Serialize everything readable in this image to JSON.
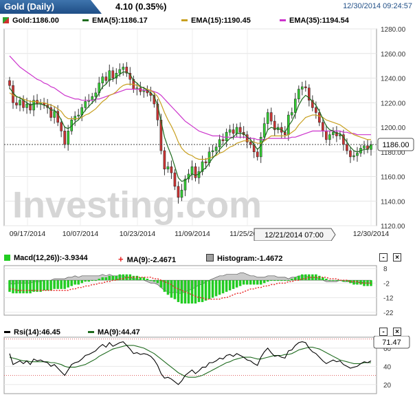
{
  "header": {
    "title": "Gold (Daily)",
    "change": "4.10 (0.35%)",
    "datetime": "12/30/2014 09:24:57"
  },
  "price_legend": [
    {
      "label": "Gold:1186.00",
      "color": "#2ea02e",
      "icon": "candlestick-icon"
    },
    {
      "label": "EMA(5):1186.17",
      "color": "#1e6b1e",
      "icon": "line-swatch"
    },
    {
      "label": "EMA(15):1190.45",
      "color": "#c8a020",
      "icon": "line-swatch"
    },
    {
      "label": "EMA(35):1194.54",
      "color": "#cc33cc",
      "icon": "line-swatch"
    }
  ],
  "macd_legend": [
    {
      "label": "Macd(12,26)):-3.9344",
      "color": "#22cc22",
      "icon": "square-swatch"
    },
    {
      "label": "MA(9):-2.4671",
      "color": "#e82020",
      "icon": "plus-icon"
    },
    {
      "label": "Histogram:-1.4672",
      "color": "#a0a0a0",
      "icon": "square-swatch"
    }
  ],
  "rsi_legend": [
    {
      "label": "Rsi(14):46.45",
      "color": "#000000",
      "icon": "line-swatch"
    },
    {
      "label": "MA(9):44.47",
      "color": "#1e6b1e",
      "icon": "line-swatch"
    }
  ],
  "controls": {
    "minimize": "-",
    "close": "×"
  },
  "watermark": "Investing.com",
  "crosshair_label": "12/21/2014 07:00",
  "chart_data": [
    {
      "type": "candlestick",
      "title": "Gold (Daily)",
      "ylim": [
        1120,
        1280
      ],
      "y_ticks": [
        1280,
        1260,
        1240,
        1220,
        1200,
        1180,
        1160,
        1140,
        1120
      ],
      "x_tick_labels": [
        "09/17/2014",
        "10/07/2014",
        "10/23/2014",
        "11/09/2014",
        "11/25/2014",
        "12/30/2014"
      ],
      "last_price": 1186.0,
      "last_price_label": "1186.00",
      "closes": [
        1234,
        1220,
        1218,
        1222,
        1216,
        1219,
        1214,
        1222,
        1219,
        1220,
        1218,
        1216,
        1208,
        1213,
        1204,
        1197,
        1186,
        1197,
        1206,
        1209,
        1210,
        1216,
        1221,
        1222,
        1225,
        1228,
        1236,
        1241,
        1238,
        1246,
        1240,
        1244,
        1247,
        1249,
        1244,
        1239,
        1231,
        1232,
        1229,
        1230,
        1228,
        1226,
        1219,
        1206,
        1181,
        1166,
        1168,
        1163,
        1152,
        1143,
        1149,
        1158,
        1162,
        1168,
        1159,
        1164,
        1172,
        1171,
        1180,
        1181,
        1184,
        1190,
        1189,
        1196,
        1198,
        1195,
        1200,
        1196,
        1194,
        1188,
        1186,
        1180,
        1176,
        1192,
        1203,
        1212,
        1205,
        1198,
        1200,
        1196,
        1194,
        1210,
        1212,
        1223,
        1231,
        1233,
        1232,
        1222,
        1216,
        1212,
        1204,
        1197,
        1190,
        1194,
        1196,
        1193,
        1194,
        1186,
        1181,
        1176,
        1177,
        1179,
        1183,
        1185,
        1182,
        1186
      ],
      "ema5": [
        1232,
        1228,
        1225,
        1224,
        1222,
        1220,
        1218,
        1219,
        1219,
        1219,
        1218,
        1217,
        1214,
        1214,
        1211,
        1206,
        1200,
        1199,
        1201,
        1204,
        1206,
        1210,
        1214,
        1217,
        1220,
        1223,
        1228,
        1233,
        1235,
        1239,
        1239,
        1241,
        1243,
        1245,
        1245,
        1243,
        1238,
        1236,
        1233,
        1232,
        1230,
        1228,
        1225,
        1218,
        1205,
        1192,
        1184,
        1177,
        1168,
        1159,
        1156,
        1157,
        1159,
        1162,
        1161,
        1162,
        1165,
        1167,
        1171,
        1175,
        1178,
        1182,
        1185,
        1188,
        1191,
        1192,
        1195,
        1195,
        1195,
        1192,
        1190,
        1186,
        1182,
        1185,
        1191,
        1198,
        1200,
        1199,
        1199,
        1198,
        1196,
        1201,
        1205,
        1211,
        1218,
        1223,
        1226,
        1224,
        1221,
        1218,
        1213,
        1207,
        1201,
        1198,
        1197,
        1195,
        1195,
        1192,
        1188,
        1184,
        1181,
        1180,
        1181,
        1182,
        1182,
        1186
      ],
      "ema15": [
        1228,
        1226,
        1225,
        1224,
        1223,
        1222,
        1221,
        1221,
        1221,
        1220,
        1220,
        1219,
        1218,
        1217,
        1215,
        1213,
        1209,
        1207,
        1207,
        1207,
        1207,
        1208,
        1210,
        1211,
        1213,
        1215,
        1218,
        1221,
        1223,
        1226,
        1227,
        1229,
        1232,
        1234,
        1235,
        1235,
        1235,
        1234,
        1233,
        1232,
        1231,
        1230,
        1228,
        1225,
        1219,
        1212,
        1206,
        1201,
        1195,
        1188,
        1183,
        1180,
        1178,
        1177,
        1175,
        1174,
        1174,
        1174,
        1175,
        1176,
        1177,
        1179,
        1180,
        1182,
        1184,
        1185,
        1187,
        1188,
        1189,
        1189,
        1189,
        1188,
        1187,
        1187,
        1189,
        1191,
        1193,
        1193,
        1193,
        1193,
        1193,
        1194,
        1196,
        1198,
        1202,
        1205,
        1208,
        1209,
        1210,
        1210,
        1209,
        1208,
        1206,
        1205,
        1204,
        1203,
        1202,
        1200,
        1198,
        1196,
        1194,
        1193,
        1192,
        1191,
        1190,
        1190
      ],
      "ema35": [
        1258,
        1255,
        1252,
        1249,
        1247,
        1245,
        1243,
        1241,
        1239,
        1238,
        1236,
        1235,
        1233,
        1232,
        1230,
        1228,
        1226,
        1225,
        1224,
        1223,
        1223,
        1222,
        1222,
        1222,
        1222,
        1223,
        1223,
        1224,
        1225,
        1226,
        1227,
        1228,
        1229,
        1230,
        1231,
        1231,
        1231,
        1231,
        1231,
        1230,
        1230,
        1230,
        1229,
        1228,
        1226,
        1223,
        1220,
        1217,
        1214,
        1211,
        1208,
        1205,
        1203,
        1201,
        1199,
        1197,
        1196,
        1195,
        1194,
        1193,
        1193,
        1193,
        1192,
        1192,
        1192,
        1192,
        1192,
        1192,
        1192,
        1192,
        1191,
        1191,
        1190,
        1190,
        1190,
        1191,
        1191,
        1191,
        1191,
        1191,
        1191,
        1191,
        1192,
        1192,
        1193,
        1194,
        1195,
        1196,
        1197,
        1197,
        1197,
        1197,
        1197,
        1197,
        1197,
        1197,
        1197,
        1196,
        1196,
        1195,
        1195,
        1194,
        1194,
        1194,
        1194,
        1194
      ]
    },
    {
      "type": "line",
      "title": "Macd(12,26)",
      "ylim": [
        -24,
        10
      ],
      "y_ticks": [
        8,
        -2,
        -12,
        -22
      ],
      "macd": [
        -8,
        -9,
        -9,
        -9,
        -9,
        -9,
        -9,
        -8,
        -8,
        -8,
        -7,
        -7,
        -7,
        -6,
        -6,
        -6,
        -6,
        -5,
        -4,
        -3,
        -3,
        -2,
        -1,
        -1,
        0,
        0,
        1,
        2,
        2,
        3,
        3,
        3,
        4,
        4,
        4,
        4,
        3,
        3,
        2,
        2,
        1,
        0,
        -1,
        -2,
        -5,
        -8,
        -10,
        -12,
        -13,
        -15,
        -16,
        -16,
        -16,
        -16,
        -16,
        -15,
        -15,
        -14,
        -13,
        -12,
        -11,
        -10,
        -9,
        -8,
        -7,
        -6,
        -5,
        -4,
        -3,
        -3,
        -3,
        -3,
        -3,
        -3,
        -2,
        -1,
        0,
        0,
        0,
        0,
        0,
        0,
        1,
        2,
        3,
        4,
        4,
        4,
        4,
        4,
        3,
        2,
        1,
        0,
        0,
        0,
        0,
        -1,
        -1,
        -2,
        -3,
        -3,
        -3,
        -4,
        -4,
        -4
      ],
      "signal": [
        -6,
        -6,
        -7,
        -7,
        -7,
        -7,
        -7,
        -7,
        -7,
        -7,
        -7,
        -7,
        -7,
        -7,
        -7,
        -7,
        -7,
        -7,
        -6,
        -6,
        -5,
        -5,
        -4,
        -4,
        -3,
        -3,
        -2,
        -2,
        -1,
        -1,
        0,
        0,
        1,
        1,
        2,
        2,
        2,
        2,
        2,
        2,
        2,
        2,
        1,
        1,
        0,
        -1,
        -2,
        -3,
        -5,
        -6,
        -7,
        -8,
        -9,
        -10,
        -11,
        -12,
        -12,
        -13,
        -13,
        -13,
        -13,
        -13,
        -12,
        -12,
        -11,
        -10,
        -9,
        -9,
        -8,
        -7,
        -6,
        -6,
        -5,
        -5,
        -4,
        -4,
        -3,
        -3,
        -2,
        -2,
        -2,
        -1,
        -1,
        0,
        0,
        1,
        1,
        2,
        2,
        2,
        2,
        2,
        2,
        1,
        1,
        1,
        0,
        0,
        0,
        -1,
        -1,
        -1,
        -2,
        -2,
        -2,
        -2
      ]
    },
    {
      "type": "line",
      "title": "Rsi(14)",
      "ylim": [
        30,
        70
      ],
      "y_ticks": [
        60,
        40,
        20
      ],
      "current_label": "71.47",
      "rsi": [
        54,
        42,
        44,
        46,
        43,
        46,
        42,
        48,
        46,
        47,
        45,
        44,
        40,
        42,
        38,
        34,
        30,
        36,
        42,
        44,
        45,
        48,
        52,
        53,
        55,
        57,
        61,
        64,
        61,
        66,
        62,
        64,
        66,
        67,
        63,
        59,
        54,
        55,
        53,
        54,
        53,
        51,
        47,
        41,
        32,
        27,
        28,
        26,
        23,
        20,
        24,
        30,
        33,
        36,
        32,
        35,
        39,
        39,
        44,
        44,
        46,
        49,
        48,
        52,
        53,
        51,
        54,
        52,
        50,
        47,
        46,
        43,
        41,
        50,
        56,
        60,
        55,
        51,
        52,
        50,
        49,
        57,
        58,
        63,
        66,
        67,
        66,
        60,
        56,
        54,
        50,
        46,
        43,
        45,
        47,
        45,
        46,
        42,
        40,
        38,
        39,
        40,
        43,
        45,
        44,
        46
      ],
      "ma9": [
        50,
        49,
        48,
        47,
        46,
        46,
        45,
        45,
        45,
        45,
        45,
        45,
        44,
        44,
        43,
        42,
        40,
        39,
        39,
        39,
        40,
        41,
        42,
        44,
        46,
        48,
        51,
        53,
        55,
        57,
        59,
        60,
        61,
        62,
        63,
        63,
        63,
        62,
        61,
        60,
        58,
        56,
        54,
        51,
        48,
        45,
        42,
        39,
        36,
        33,
        31,
        29,
        28,
        28,
        28,
        29,
        30,
        32,
        34,
        36,
        38,
        40,
        42,
        44,
        45,
        47,
        48,
        49,
        50,
        50,
        50,
        49,
        48,
        48,
        49,
        50,
        51,
        52,
        52,
        52,
        53,
        53,
        54,
        56,
        58,
        59,
        60,
        61,
        61,
        60,
        59,
        57,
        55,
        53,
        51,
        49,
        47,
        46,
        45,
        44,
        43,
        43,
        43,
        44,
        44,
        44
      ]
    }
  ]
}
